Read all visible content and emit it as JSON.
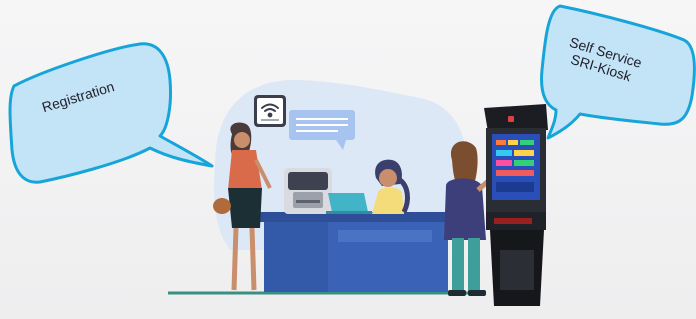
{
  "bubbles": {
    "registration": "Registration",
    "kiosk_line1": "Self Service",
    "kiosk_line2": "SRI-Kiosk"
  },
  "colors": {
    "bubble_fill": "#bfe3f6",
    "bubble_stroke": "#16a4d8",
    "counter": "#3a63b7",
    "backdrop": "#dbe6f7"
  },
  "icons": [
    "wifi-icon",
    "chat-bubble-icon",
    "printer-icon",
    "laptop-icon",
    "kiosk-screen-icon"
  ]
}
